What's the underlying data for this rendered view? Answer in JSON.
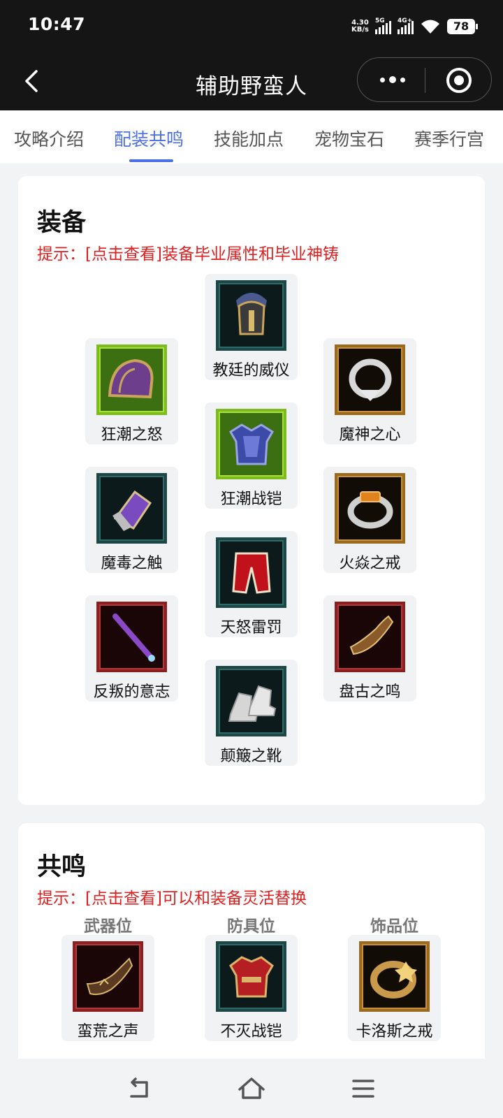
{
  "status": {
    "time": "10:47",
    "speed_value": "4.30",
    "speed_unit": "KB/s",
    "sim1": "5G",
    "sim2": "4G+",
    "battery": "78"
  },
  "nav": {
    "title": "辅助野蛮人"
  },
  "tabs": [
    {
      "label": "攻略介绍"
    },
    {
      "label": "配装共鸣"
    },
    {
      "label": "技能加点"
    },
    {
      "label": "宠物宝石"
    },
    {
      "label": "赛季行宫"
    }
  ],
  "equipment": {
    "title": "装备",
    "hint": "提示：[点击查看]装备毕业属性和毕业神铸",
    "items": [
      {
        "name": "教廷的威仪",
        "icon": "helmet-icon"
      },
      {
        "name": "狂潮之怒",
        "icon": "shoulder-icon"
      },
      {
        "name": "魔神之心",
        "icon": "amulet-icon"
      },
      {
        "name": "狂潮战铠",
        "icon": "chest-armor-icon"
      },
      {
        "name": "魔毒之触",
        "icon": "gloves-icon"
      },
      {
        "name": "火焱之戒",
        "icon": "ring-icon"
      },
      {
        "name": "天怒雷罚",
        "icon": "pants-icon"
      },
      {
        "name": "反叛的意志",
        "icon": "spiked-staff-icon"
      },
      {
        "name": "盘古之鸣",
        "icon": "horn-icon"
      },
      {
        "name": "颠簸之靴",
        "icon": "boots-icon"
      }
    ]
  },
  "resonance": {
    "title": "共鸣",
    "hint": "提示：[点击查看]可以和装备灵活替换",
    "slots": [
      {
        "position": "武器位",
        "name": "蛮荒之声",
        "icon": "war-horn-icon"
      },
      {
        "position": "防具位",
        "name": "不灭战铠",
        "icon": "red-armor-icon"
      },
      {
        "position": "饰品位",
        "name": "卡洛斯之戒",
        "icon": "gold-ring-icon"
      }
    ]
  },
  "colors": {
    "accent": "#4b6fe6",
    "hint": "#e02020",
    "frame_teal": "#1f4e4e",
    "frame_green": "#7dbb1f",
    "frame_gold": "#9a6a1e",
    "frame_red": "#8c2020"
  }
}
